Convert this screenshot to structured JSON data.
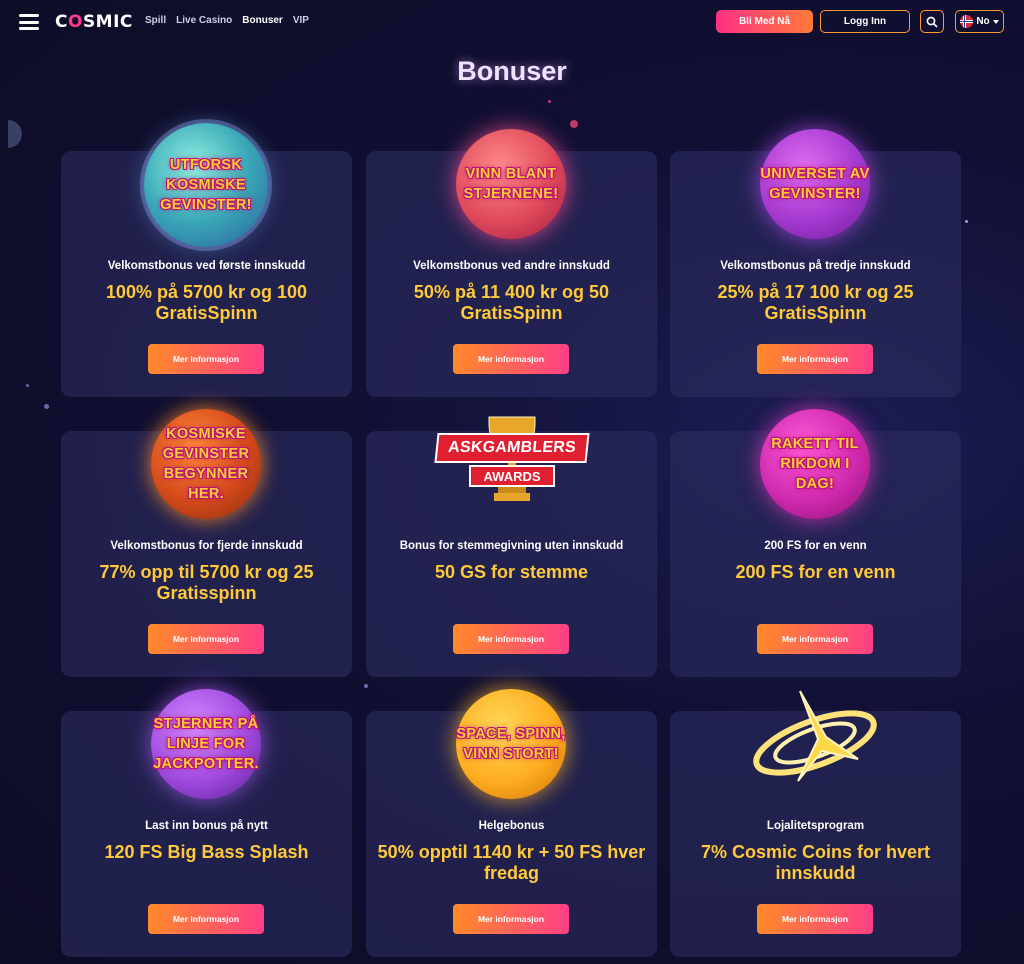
{
  "header": {
    "logo": {
      "pre": "C",
      "o": "O",
      "post": "SMIC"
    },
    "nav": [
      "Spill",
      "Live Casino",
      "Bonuser",
      "VIP"
    ],
    "nav_active": "Bonuser",
    "join_label": "Bli Med Nå",
    "login_label": "Logg Inn",
    "lang_label": "No"
  },
  "page": {
    "title": "Bonuser"
  },
  "common": {
    "more_label": "Mer informasjon"
  },
  "cards": [
    {
      "art_text": "UTFORSK KOSMISKE GEVINSTER!",
      "art_icon": "teal-planet-icon",
      "subtitle": "Velkomstbonus ved første innskudd",
      "offer": "100% på 5700 kr og 100 GratisSpinn"
    },
    {
      "art_text": "VINN BLANT STJERNENE!",
      "art_icon": "red-planet-icon",
      "subtitle": "Velkomstbonus ved andre innskudd",
      "offer": "50% på 11 400 kr og 50 GratisSpinn"
    },
    {
      "art_text": "UNIVERSET AV GEVINSTER!",
      "art_icon": "purple-planet-icon",
      "subtitle": "Velkomstbonus på tredje innskudd",
      "offer": "25% på 17 100 kr og 25 GratisSpinn"
    },
    {
      "art_text": "KOSMISKE GEVINSTER BEGYNNER HER.",
      "art_icon": "orange-planet-icon",
      "subtitle": "Velkomstbonus for fjerde innskudd",
      "offer": "77% opp til 5700 kr og 25 Gratisspinn"
    },
    {
      "art_text": "ASKGAMBLERS",
      "art_text2": "AWARDS",
      "art_icon": "trophy-icon",
      "subtitle": "Bonus for stemmegivning uten innskudd",
      "offer": "50 GS for stemme"
    },
    {
      "art_text": "RAKETT TIL RIKDOM I DAG!",
      "art_icon": "magenta-planet-icon",
      "subtitle": "200 FS for en venn",
      "offer": "200 FS for en venn"
    },
    {
      "art_text": "STJERNER PÅ LINJE FOR JACKPOTTER.",
      "art_icon": "violet-planet-icon",
      "subtitle": "Last inn bonus på nytt",
      "offer": "120 FS Big Bass Splash"
    },
    {
      "art_text": "SPACE, SPINN, VINN STORT!",
      "art_icon": "yellow-planet-icon",
      "subtitle": "Helgebonus",
      "offer": "50% opptil 1140 kr + 50 FS hver fredag"
    },
    {
      "art_text": "",
      "art_icon": "galaxy-icon",
      "subtitle": "Lojalitetsprogram",
      "offer": "7% Cosmic Coins for hvert innskudd"
    }
  ],
  "colors": {
    "accent_gold": "#ffc93a",
    "button_gradient": [
      "#ff8a2a",
      "#ff3f86"
    ],
    "border_orange": "#ff9b2e",
    "background": "#0d0c26"
  }
}
